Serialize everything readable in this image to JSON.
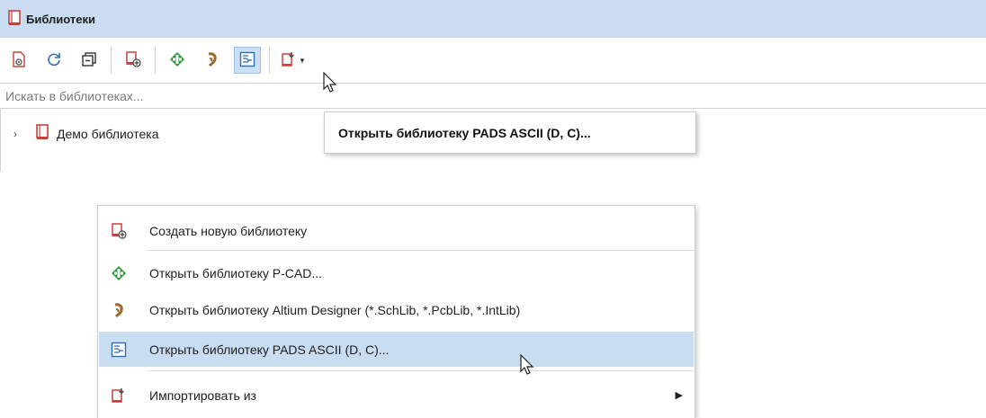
{
  "panel": {
    "title": "Библиотеки"
  },
  "toolbar": {
    "buttons": [
      {
        "icon": "library-view-icon"
      },
      {
        "icon": "refresh-icon"
      },
      {
        "icon": "collapse-icon"
      },
      {
        "icon": "new-library-icon"
      },
      {
        "icon": "pcad-icon"
      },
      {
        "icon": "altium-icon"
      },
      {
        "icon": "pads-icon"
      },
      {
        "icon": "import-icon"
      }
    ]
  },
  "search": {
    "placeholder": "Искать в библиотеках..."
  },
  "tree": {
    "items": [
      {
        "label": "Демо библиотека"
      }
    ]
  },
  "tooltip": {
    "text": "Открыть библиотеку PADS ASCII (D, C)..."
  },
  "menu": {
    "items": [
      {
        "label": "Создать новую библиотеку"
      },
      {
        "label": "Открыть библиотеку P-CAD..."
      },
      {
        "label": "Открыть библиотеку Altium Designer (*.SchLib, *.PcbLib, *.IntLib)"
      },
      {
        "label": "Открыть библиотеку PADS ASCII (D, C)..."
      },
      {
        "label": "Импортировать из"
      }
    ]
  },
  "colors": {
    "header_bg": "#c9dcf1",
    "highlight": "#c8ddf2",
    "library_red": "#c8413a",
    "pcad_green": "#2f9b3d",
    "altium_brown": "#a0692a",
    "pads_blue": "#2f6db4"
  }
}
